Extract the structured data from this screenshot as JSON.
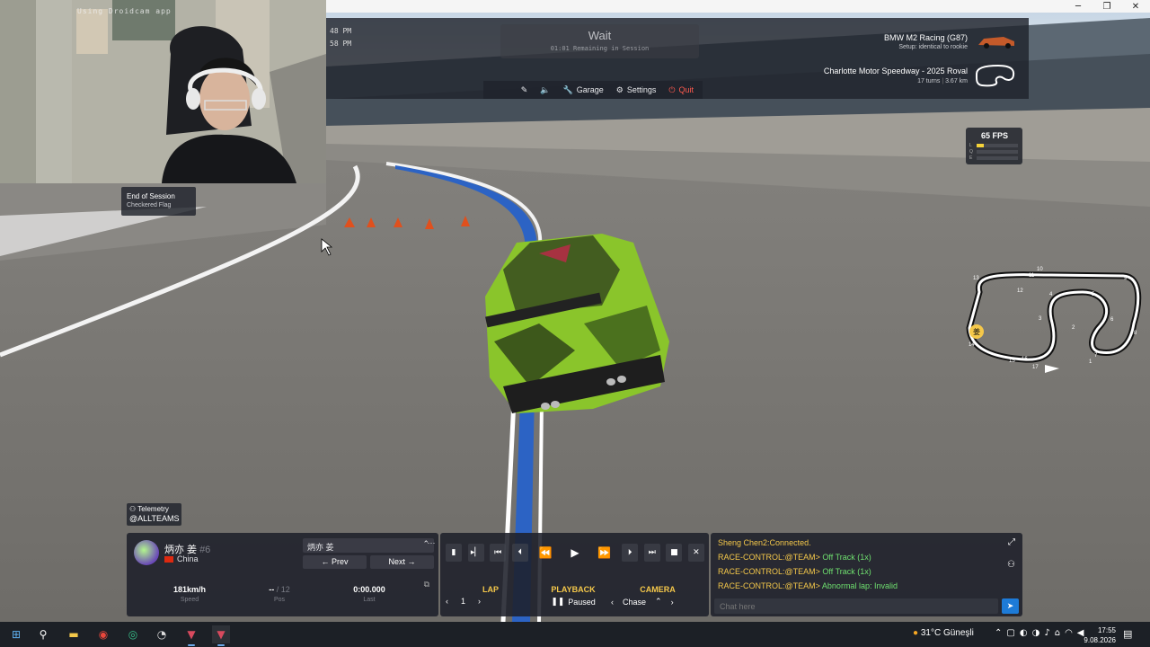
{
  "webcam": {
    "overlay_text": "Using Droidcam app"
  },
  "session": {
    "time_top": "48 PM",
    "time_bottom": "58 PM",
    "status": "Wait",
    "remaining": "01:01 Remaining in Session"
  },
  "car": {
    "name": "BMW M2 Racing (G87)",
    "setup": "Setup: identical to rookie"
  },
  "track": {
    "name": "Charlotte Motor Speedway -  2025 Roval",
    "turns": "17 turns",
    "length": "3.67 km"
  },
  "top_actions": {
    "garage": "Garage",
    "settings": "Settings",
    "quit": "Quit"
  },
  "fps": {
    "value": "65 FPS",
    "rows": [
      "L",
      "Q",
      "E"
    ]
  },
  "session_state": {
    "title": "End of Session",
    "subtitle": "Checkered Flag"
  },
  "telemetry": {
    "title": "Telemetry",
    "team": "@ALLTEAMS"
  },
  "driver": {
    "name": "炳亦 姜",
    "number": "#6",
    "country": "China",
    "selected": "炳亦 姜",
    "prev": "← Prev",
    "next": "Next →",
    "speed_value": "181km/h",
    "speed_label": "Speed",
    "pos_value": "--",
    "pos_total": "/ 12",
    "pos_label": "Pos",
    "last_value": "0:00.000",
    "last_label": "Last"
  },
  "playback": {
    "lap_label": "LAP",
    "lap_value": "1",
    "playback_label": "PLAYBACK",
    "playback_value": "Paused",
    "camera_label": "CAMERA",
    "camera_value": "Chase"
  },
  "chat": {
    "lines": [
      {
        "who": "Sheng Chen2:",
        "msg": "Connected."
      },
      {
        "who": "RACE-CONTROL:@TEAM>",
        "msg": "Off Track (1x)"
      },
      {
        "who": "RACE-CONTROL:@TEAM>",
        "msg": "Off Track (1x)"
      },
      {
        "who": "RACE-CONTROL:@TEAM>",
        "msg": "Abnormal lap: Invalid"
      }
    ],
    "placeholder": "Chat here"
  },
  "track_map": {
    "driver_marker": "姜",
    "turn_labels": [
      "1",
      "2",
      "3",
      "4",
      "5",
      "6",
      "7",
      "8",
      "9",
      "10",
      "11",
      "12",
      "13",
      "14",
      "15",
      "16",
      "17"
    ]
  },
  "taskbar": {
    "weather": "31°C  Güneşli",
    "time": "17:55",
    "date": "9.08.2026"
  },
  "icons": {
    "accent_quit": "#ff5a4e",
    "accent_yellow": "#f5c84a",
    "accent_green": "#6fe06f",
    "send_blue": "#1d7bd8"
  }
}
